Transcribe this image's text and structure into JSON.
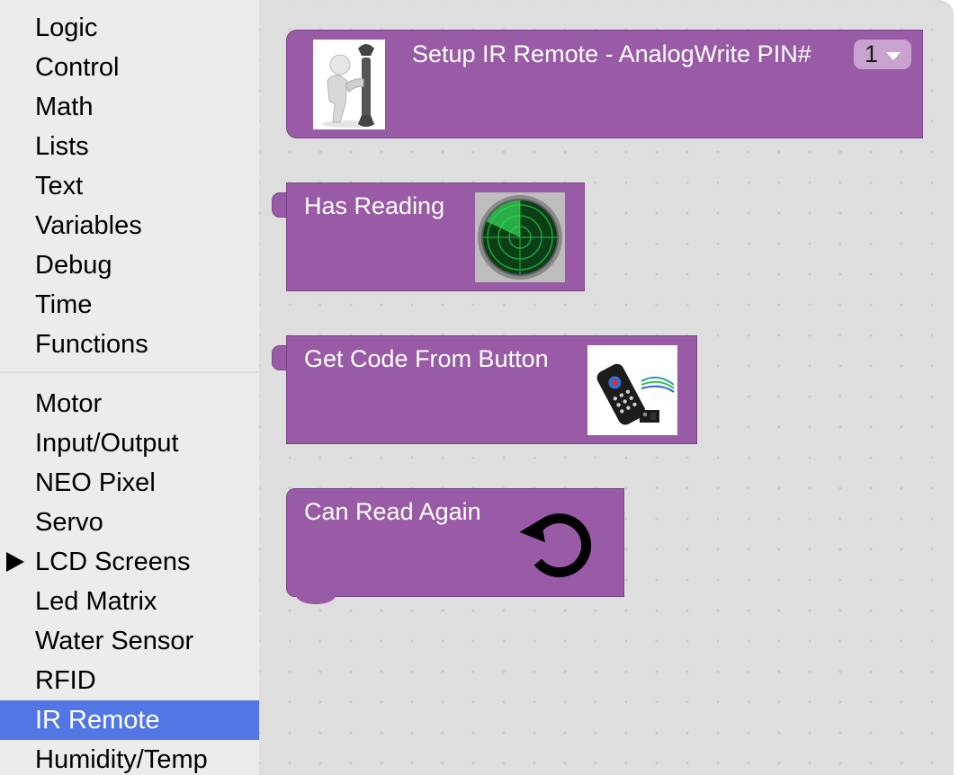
{
  "toolbox": {
    "categories_top": [
      {
        "label": "Logic"
      },
      {
        "label": "Control"
      },
      {
        "label": "Math"
      },
      {
        "label": "Lists"
      },
      {
        "label": "Text"
      },
      {
        "label": "Variables"
      },
      {
        "label": "Debug"
      },
      {
        "label": "Time"
      },
      {
        "label": "Functions"
      }
    ],
    "categories_bottom": [
      {
        "label": "Motor"
      },
      {
        "label": "Input/Output"
      },
      {
        "label": "NEO Pixel"
      },
      {
        "label": "Servo"
      },
      {
        "label": "LCD Screens"
      },
      {
        "label": "Led Matrix"
      },
      {
        "label": "Water Sensor"
      },
      {
        "label": "RFID"
      },
      {
        "label": "IR Remote"
      },
      {
        "label": "Humidity/Temp"
      }
    ],
    "selected": "IR Remote",
    "expandable": "LCD Screens"
  },
  "blocks": {
    "setup": {
      "title": "Setup IR Remote - AnalogWrite PIN#",
      "pin_value": "1",
      "icon": "wrench-person-icon"
    },
    "has_reading": {
      "title": "Has Reading",
      "icon": "radar-icon"
    },
    "get_code": {
      "title": "Get Code From Button",
      "icon": "ir-remote-icon"
    },
    "can_read_again": {
      "title": "Can Read Again",
      "icon": "reset-arrow-icon"
    }
  },
  "colors": {
    "block": "#995ba5",
    "selected_category": "#5276e4",
    "workspace": "#dedede",
    "toolbox": "#ececec"
  }
}
